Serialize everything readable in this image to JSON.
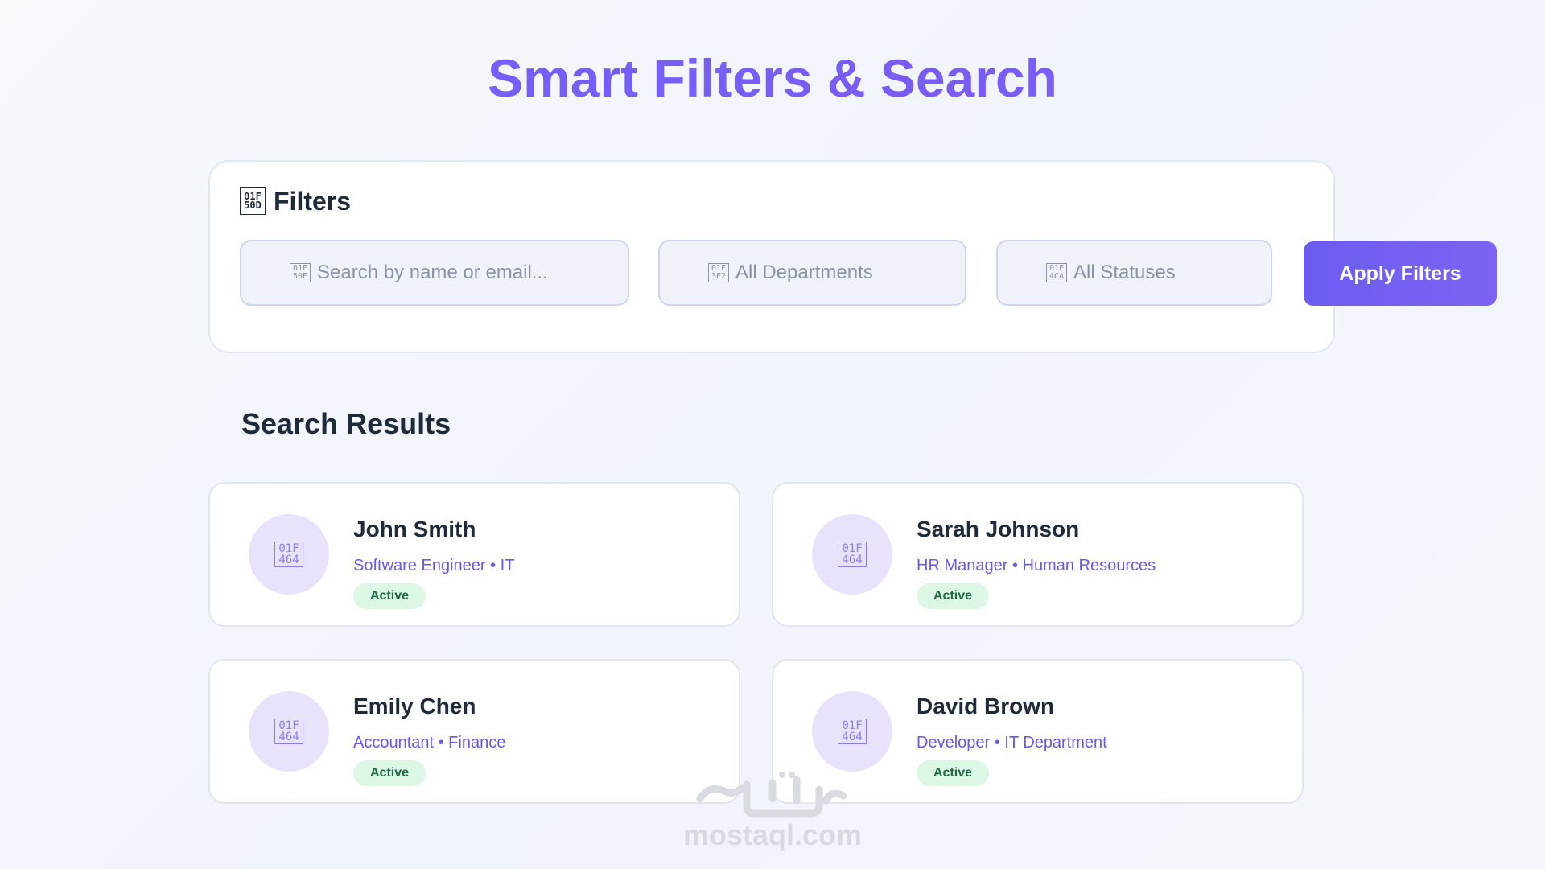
{
  "header": {
    "title": "Smart Filters & Search"
  },
  "filters": {
    "icon": "magnifier-icon",
    "icon_glyph": "01F\n50D",
    "heading": "Filters",
    "search": {
      "icon": "search-icon",
      "icon_glyph": "01F\n50E",
      "placeholder": "Search by name or email..."
    },
    "department": {
      "icon": "building-icon",
      "icon_glyph": "01F\n3E2",
      "selected": "All Departments"
    },
    "status": {
      "icon": "chart-icon",
      "icon_glyph": "01F\n4CA",
      "selected": "All Statuses"
    },
    "apply_label": "Apply Filters"
  },
  "results": {
    "title": "Search Results",
    "items": [
      {
        "name": "John Smith",
        "role": "Software Engineer",
        "department": "IT",
        "meta": "Software Engineer • IT",
        "status": "Active",
        "avatar_glyph": "01F\n464"
      },
      {
        "name": "Sarah Johnson",
        "role": "HR Manager",
        "department": "Human Resources",
        "meta": "HR Manager • Human Resources",
        "status": "Active",
        "avatar_glyph": "01F\n464"
      },
      {
        "name": "Emily Chen",
        "role": "Accountant",
        "department": "Finance",
        "meta": "Accountant • Finance",
        "status": "Active",
        "avatar_glyph": "01F\n464"
      },
      {
        "name": "David Brown",
        "role": "Developer",
        "department": "IT Department",
        "meta": "Developer • IT Department",
        "status": "Active",
        "avatar_glyph": "01F\n464"
      }
    ]
  },
  "watermark": {
    "text": "mostaql.com"
  },
  "colors": {
    "accent": "#6c63ff",
    "status_active_bg": "#dcf7e6",
    "status_active_text": "#1e6b41"
  }
}
